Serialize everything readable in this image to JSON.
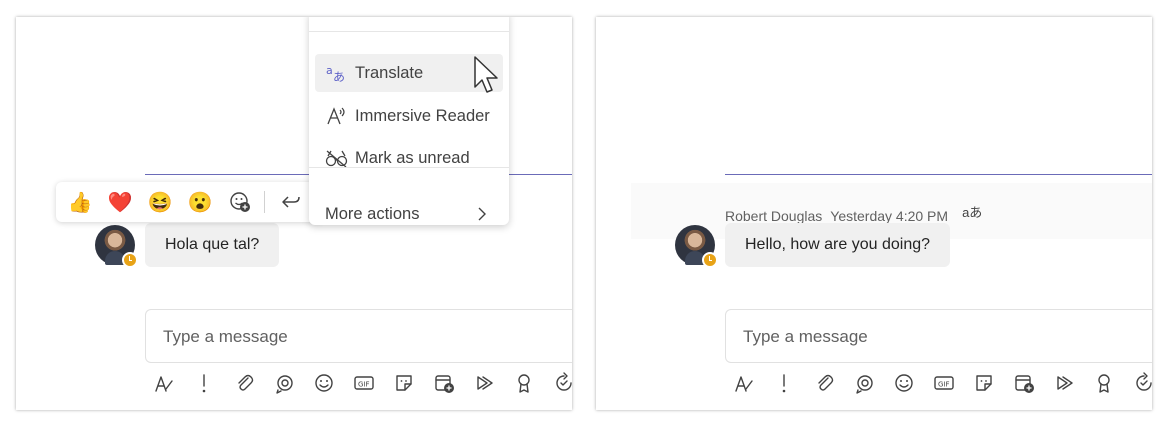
{
  "left": {
    "message": "Hola que tal?",
    "reactions": [
      "👍",
      "❤️",
      "😆",
      "😮"
    ],
    "menu": {
      "items": [
        {
          "label": "Translate"
        },
        {
          "label": "Immersive Reader"
        },
        {
          "label": "Mark as unread"
        }
      ],
      "more_actions": "More actions"
    },
    "compose_placeholder": "Type a message"
  },
  "right": {
    "sender": "Robert Douglas",
    "time": "Yesterday 4:20 PM",
    "translated_icon": "aあ",
    "message": "Hello, how are you doing?",
    "compose_placeholder": "Type a message"
  },
  "icons": [
    "format-icon",
    "urgent-icon",
    "attach-icon",
    "loop-icon",
    "emoji-icon",
    "gif-icon",
    "sticker-icon",
    "schedule-meeting-icon",
    "stream-icon",
    "praise-icon",
    "updates-icon"
  ],
  "colors": {
    "accent": "#5b5fc7",
    "presence_away": "#e8a317",
    "bubble": "#f0f0f0"
  }
}
